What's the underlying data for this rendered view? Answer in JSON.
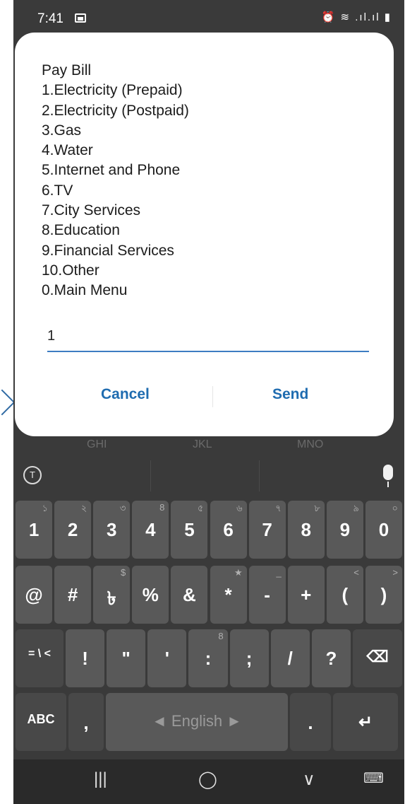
{
  "status": {
    "time": "7:41",
    "right": "⏰ ≋ .ıl.ıl ▮"
  },
  "dialog": {
    "title": "Pay Bill",
    "options": [
      "1.Electricity (Prepaid)",
      "2.Electricity (Postpaid)",
      "3.Gas",
      "4.Water",
      "5.Internet and Phone",
      "6.TV",
      "7.City Services",
      "8.Education",
      "9.Financial Services",
      "10.Other",
      "0.Main Menu"
    ],
    "input_value": "1",
    "cancel_label": "Cancel",
    "send_label": "Send"
  },
  "keyboard": {
    "t9_labels": [
      "GHI",
      "JKL",
      "MNO"
    ],
    "row1": [
      {
        "main": "1",
        "sup": "১"
      },
      {
        "main": "2",
        "sup": "২"
      },
      {
        "main": "3",
        "sup": "৩"
      },
      {
        "main": "4",
        "sup": "8"
      },
      {
        "main": "5",
        "sup": "৫"
      },
      {
        "main": "6",
        "sup": "৬"
      },
      {
        "main": "7",
        "sup": "৭"
      },
      {
        "main": "8",
        "sup": "৮"
      },
      {
        "main": "9",
        "sup": "৯"
      },
      {
        "main": "0",
        "sup": "০"
      }
    ],
    "row2": [
      {
        "main": "@",
        "sup": ""
      },
      {
        "main": "#",
        "sup": ""
      },
      {
        "main": "৳",
        "sup": "$"
      },
      {
        "main": "%",
        "sup": ""
      },
      {
        "main": "&",
        "sup": ""
      },
      {
        "main": "*",
        "sup": "★"
      },
      {
        "main": "-",
        "sup": "_"
      },
      {
        "main": "+",
        "sup": ""
      },
      {
        "main": "(",
        "sup": "<"
      },
      {
        "main": ")",
        "sup": ">"
      }
    ],
    "row3": [
      {
        "main": "= \\ <",
        "sup": ""
      },
      {
        "main": "!",
        "sup": ""
      },
      {
        "main": "\"",
        "sup": ""
      },
      {
        "main": "'",
        "sup": ""
      },
      {
        "main": ":",
        "sup": "8"
      },
      {
        "main": ";",
        "sup": ""
      },
      {
        "main": "/",
        "sup": ""
      },
      {
        "main": "?",
        "sup": ""
      },
      {
        "main": "⌫",
        "sup": ""
      }
    ],
    "row4": {
      "abc": "ABC",
      "comma": ",",
      "space": "◄  English  ►",
      "period": ".",
      "enter": "↵"
    }
  },
  "nav": {
    "recents": "|||",
    "home": "◯",
    "back": "∨",
    "keyboard": "⌨"
  }
}
